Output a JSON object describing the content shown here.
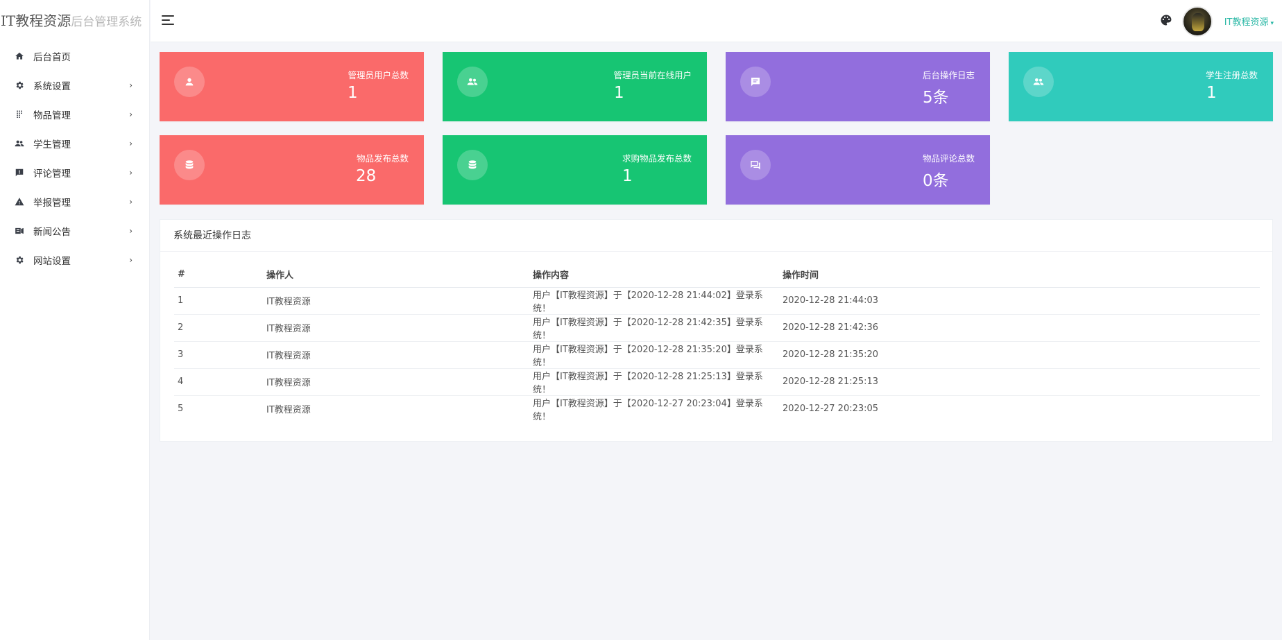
{
  "brand": {
    "main": "IT教程资源",
    "sub": "后台管理系统"
  },
  "sidebar": {
    "items": [
      {
        "label": "后台首页",
        "icon": "home-icon",
        "arrow": ""
      },
      {
        "label": "系统设置",
        "icon": "gear-icon",
        "arrow": "›"
      },
      {
        "label": "物品管理",
        "icon": "grid-dots-icon",
        "arrow": "›"
      },
      {
        "label": "学生管理",
        "icon": "users-icon",
        "arrow": "›"
      },
      {
        "label": "评论管理",
        "icon": "comment-alert-icon",
        "arrow": "›"
      },
      {
        "label": "举报管理",
        "icon": "warning-icon",
        "arrow": "›"
      },
      {
        "label": "新闻公告",
        "icon": "news-icon",
        "arrow": "›"
      },
      {
        "label": "网站设置",
        "icon": "gear-icon",
        "arrow": "›"
      }
    ]
  },
  "header": {
    "username": "IT教程资源",
    "caret": "▾",
    "username_color": "#2bb8a6"
  },
  "cards": [
    {
      "title": "管理员用户总数",
      "value": "1",
      "color": "#fa6a6a",
      "icon": "user-icon"
    },
    {
      "title": "管理员当前在线用户",
      "value": "1",
      "color": "#17c573",
      "icon": "users-icon"
    },
    {
      "title": "后台操作日志",
      "value": "5条",
      "color": "#926edd",
      "icon": "message-icon"
    },
    {
      "title": "学生注册总数",
      "value": "1",
      "color": "#30cbbc",
      "icon": "users-icon"
    },
    {
      "title": "物品发布总数",
      "value": "28",
      "color": "#fa6a6a",
      "icon": "database-icon"
    },
    {
      "title": "求购物品发布总数",
      "value": "1",
      "color": "#17c573",
      "icon": "database-icon"
    },
    {
      "title": "物品评论总数",
      "value": "0条",
      "color": "#926edd",
      "icon": "comments-icon"
    }
  ],
  "log_panel": {
    "title": "系统最近操作日志",
    "columns": [
      "#",
      "操作人",
      "操作内容",
      "操作时间"
    ],
    "rows": [
      [
        "1",
        "IT教程资源",
        "用户【IT教程资源】于【2020-12-28 21:44:02】登录系统！",
        "2020-12-28 21:44:03"
      ],
      [
        "2",
        "IT教程资源",
        "用户【IT教程资源】于【2020-12-28 21:42:35】登录系统！",
        "2020-12-28 21:42:36"
      ],
      [
        "3",
        "IT教程资源",
        "用户【IT教程资源】于【2020-12-28 21:35:20】登录系统！",
        "2020-12-28 21:35:20"
      ],
      [
        "4",
        "IT教程资源",
        "用户【IT教程资源】于【2020-12-28 21:25:13】登录系统！",
        "2020-12-28 21:25:13"
      ],
      [
        "5",
        "IT教程资源",
        "用户【IT教程资源】于【2020-12-27 20:23:04】登录系统！",
        "2020-12-27 20:23:05"
      ]
    ]
  }
}
